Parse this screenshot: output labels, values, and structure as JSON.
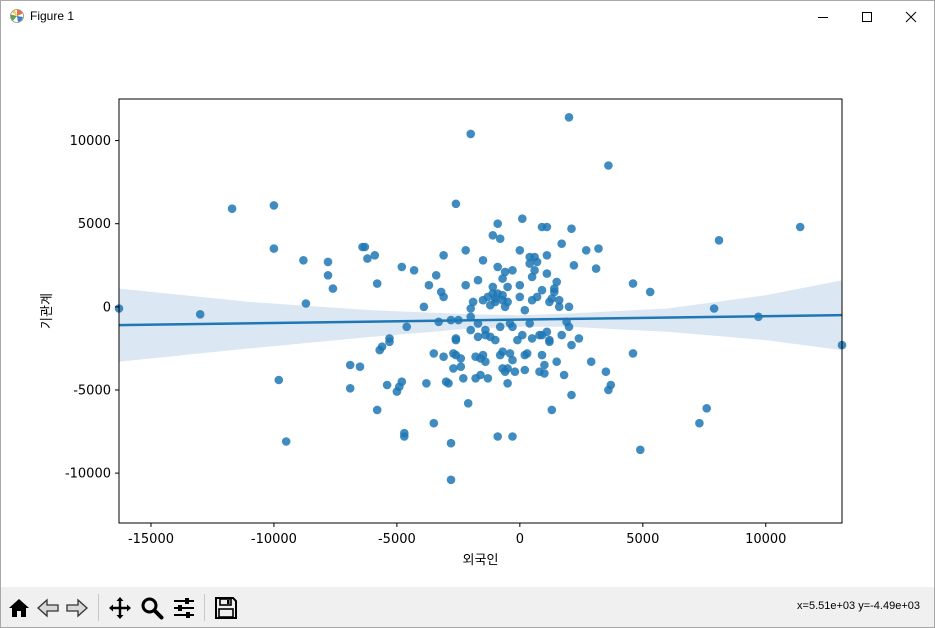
{
  "window": {
    "title": "Figure 1",
    "icons": {
      "app": "matplotlib-icon",
      "minimize": "minimize-icon",
      "maximize": "maximize-icon",
      "close": "close-icon"
    }
  },
  "toolbar": {
    "icons": [
      "home-icon",
      "back-arrow-icon",
      "forward-arrow-icon",
      "pan-move-icon",
      "zoom-magnifier-icon",
      "configure-subplots-icon",
      "save-floppy-icon"
    ],
    "coords_text": "x=5.51e+03 y=-4.49e+03"
  },
  "chart_data": {
    "type": "scatter",
    "xlabel": "외국인",
    "ylabel": "기관계",
    "xlim": [
      -16300,
      13100
    ],
    "ylim": [
      -13000,
      12500
    ],
    "x_ticks": [
      -15000,
      -10000,
      -5000,
      0,
      5000,
      10000
    ],
    "x_tick_labels": [
      "-15000",
      "-10000",
      "-5000",
      "0",
      "5000",
      "10000"
    ],
    "y_ticks": [
      -10000,
      -5000,
      0,
      5000,
      10000
    ],
    "y_tick_labels": [
      "-10000",
      "-5000",
      "0",
      "5000",
      "10000"
    ],
    "grid": false,
    "colors": {
      "points": "#1f77b4",
      "line": "#1f77b4",
      "ci_band": "#dbe7f3"
    },
    "regression": {
      "x": [
        -16300,
        13100
      ],
      "y": [
        -1100,
        -500
      ]
    },
    "confidence_band": {
      "x": [
        -16300,
        -11000,
        -6000,
        -2000,
        0,
        2000,
        6000,
        10000,
        13100
      ],
      "upper": [
        1100,
        300,
        -200,
        -450,
        -500,
        -400,
        -100,
        700,
        1600
      ],
      "lower": [
        -3300,
        -2500,
        -1800,
        -1300,
        -1200,
        -1200,
        -1500,
        -2000,
        -2600
      ]
    },
    "points": [
      [
        -16300,
        -100
      ],
      [
        -13000,
        -450
      ],
      [
        -11700,
        5900
      ],
      [
        -10000,
        6100
      ],
      [
        -10000,
        3500
      ],
      [
        -9800,
        -4400
      ],
      [
        -9500,
        -8100
      ],
      [
        -8800,
        2800
      ],
      [
        -8700,
        200
      ],
      [
        -7800,
        2700
      ],
      [
        -7800,
        1900
      ],
      [
        -7600,
        1100
      ],
      [
        -6900,
        -3500
      ],
      [
        -6900,
        -4900
      ],
      [
        -6500,
        -3600
      ],
      [
        -6400,
        3600
      ],
      [
        -6300,
        3600
      ],
      [
        -6200,
        2900
      ],
      [
        -5900,
        3100
      ],
      [
        -5800,
        1400
      ],
      [
        -5800,
        -6200
      ],
      [
        -5700,
        -2600
      ],
      [
        -5600,
        -2400
      ],
      [
        -5400,
        -4700
      ],
      [
        -5300,
        -1900
      ],
      [
        -5300,
        -2100
      ],
      [
        -5000,
        -5100
      ],
      [
        -4900,
        -4800
      ],
      [
        -4800,
        -4500
      ],
      [
        -4800,
        2400
      ],
      [
        -4700,
        -7600
      ],
      [
        -4700,
        -7800
      ],
      [
        -4600,
        -1200
      ],
      [
        -4300,
        2200
      ],
      [
        -3900,
        0
      ],
      [
        -3800,
        -4600
      ],
      [
        -3700,
        1300
      ],
      [
        -3500,
        -2800
      ],
      [
        -3500,
        -7000
      ],
      [
        -3400,
        1900
      ],
      [
        -3300,
        -900
      ],
      [
        -3200,
        900
      ],
      [
        -3100,
        600
      ],
      [
        -3100,
        3100
      ],
      [
        -3100,
        -3000
      ],
      [
        -3000,
        -4500
      ],
      [
        -2900,
        -4600
      ],
      [
        -2800,
        -10400
      ],
      [
        -2800,
        -8200
      ],
      [
        -2800,
        -800
      ],
      [
        -2700,
        -2800
      ],
      [
        -2700,
        -3700
      ],
      [
        -2600,
        6200
      ],
      [
        -2600,
        -2000
      ],
      [
        -2600,
        -2900
      ],
      [
        -2600,
        -1900
      ],
      [
        -2500,
        -800
      ],
      [
        -2400,
        -3100
      ],
      [
        -2400,
        -3600
      ],
      [
        -2300,
        -4300
      ],
      [
        -2200,
        3400
      ],
      [
        -2200,
        1300
      ],
      [
        -2100,
        -5800
      ],
      [
        -2000,
        10400
      ],
      [
        -2000,
        -1400
      ],
      [
        -2000,
        -600
      ],
      [
        -2000,
        -100
      ],
      [
        -1900,
        300
      ],
      [
        -1800,
        -3000
      ],
      [
        -1800,
        -4300
      ],
      [
        -1700,
        -1800
      ],
      [
        -1700,
        1600
      ],
      [
        -1700,
        -1000
      ],
      [
        -1600,
        -3100
      ],
      [
        -1600,
        -4100
      ],
      [
        -1500,
        2800
      ],
      [
        -1500,
        -2900
      ],
      [
        -1500,
        400
      ],
      [
        -1400,
        -1400
      ],
      [
        -1400,
        -3300
      ],
      [
        -1400,
        -1700
      ],
      [
        -1300,
        600
      ],
      [
        -1300,
        -4300
      ],
      [
        -1200,
        -1800
      ],
      [
        -1200,
        100
      ],
      [
        -1100,
        4300
      ],
      [
        -1100,
        1200
      ],
      [
        -1100,
        800
      ],
      [
        -1000,
        300
      ],
      [
        -1000,
        500
      ],
      [
        -1000,
        -2000
      ],
      [
        -900,
        5000
      ],
      [
        -900,
        2400
      ],
      [
        -900,
        -7800
      ],
      [
        -900,
        800
      ],
      [
        -800,
        4100
      ],
      [
        -800,
        -2900
      ],
      [
        -800,
        -1200
      ],
      [
        -700,
        1700
      ],
      [
        -700,
        700
      ],
      [
        -700,
        400
      ],
      [
        -700,
        -2700
      ],
      [
        -700,
        -3700
      ],
      [
        -600,
        -3900
      ],
      [
        -600,
        2100
      ],
      [
        -600,
        0
      ],
      [
        -500,
        -4600
      ],
      [
        -500,
        1200
      ],
      [
        -500,
        300
      ],
      [
        -500,
        -3700
      ],
      [
        -400,
        -1000
      ],
      [
        -400,
        -2800
      ],
      [
        -300,
        -7800
      ],
      [
        -300,
        2200
      ],
      [
        -300,
        -1200
      ],
      [
        -300,
        -3200
      ],
      [
        -200,
        -3900
      ],
      [
        -100,
        -2000
      ],
      [
        0,
        3400
      ],
      [
        0,
        1300
      ],
      [
        0,
        600
      ],
      [
        100,
        5300
      ],
      [
        100,
        -1700
      ],
      [
        200,
        -200
      ],
      [
        200,
        -2900
      ],
      [
        200,
        -3800
      ],
      [
        300,
        -2800
      ],
      [
        400,
        -1000
      ],
      [
        400,
        2600
      ],
      [
        400,
        3000
      ],
      [
        500,
        -1900
      ],
      [
        500,
        1800
      ],
      [
        500,
        400
      ],
      [
        600,
        3000
      ],
      [
        600,
        2200
      ],
      [
        700,
        2700
      ],
      [
        700,
        600
      ],
      [
        800,
        -3900
      ],
      [
        800,
        -1700
      ],
      [
        900,
        -1700
      ],
      [
        900,
        -2900
      ],
      [
        900,
        4800
      ],
      [
        900,
        1000
      ],
      [
        1000,
        -3500
      ],
      [
        1000,
        -4000
      ],
      [
        1100,
        4800
      ],
      [
        1100,
        -1500
      ],
      [
        1100,
        2000
      ],
      [
        1100,
        3100
      ],
      [
        1200,
        -2000
      ],
      [
        1200,
        300
      ],
      [
        1200,
        -2100
      ],
      [
        1300,
        500
      ],
      [
        1300,
        -6200
      ],
      [
        1400,
        900
      ],
      [
        1400,
        1100
      ],
      [
        1500,
        1500
      ],
      [
        1500,
        -3300
      ],
      [
        1600,
        400
      ],
      [
        1600,
        0
      ],
      [
        1700,
        -1700
      ],
      [
        1700,
        3800
      ],
      [
        1800,
        -4100
      ],
      [
        1900,
        -900
      ],
      [
        2000,
        -1200
      ],
      [
        2000,
        0
      ],
      [
        2000,
        11400
      ],
      [
        2100,
        4700
      ],
      [
        2100,
        -5300
      ],
      [
        2100,
        -2300
      ],
      [
        2200,
        2500
      ],
      [
        2400,
        -1900
      ],
      [
        2700,
        3400
      ],
      [
        2900,
        -3300
      ],
      [
        3100,
        2300
      ],
      [
        3200,
        3500
      ],
      [
        3500,
        -3900
      ],
      [
        3600,
        8500
      ],
      [
        3600,
        -5000
      ],
      [
        3700,
        -4700
      ],
      [
        4600,
        1400
      ],
      [
        4600,
        -2800
      ],
      [
        4900,
        -8600
      ],
      [
        5300,
        900
      ],
      [
        7300,
        -7000
      ],
      [
        7600,
        -6100
      ],
      [
        7900,
        -100
      ],
      [
        8100,
        4000
      ],
      [
        9700,
        -600
      ],
      [
        11400,
        4800
      ],
      [
        13100,
        -2300
      ]
    ]
  }
}
